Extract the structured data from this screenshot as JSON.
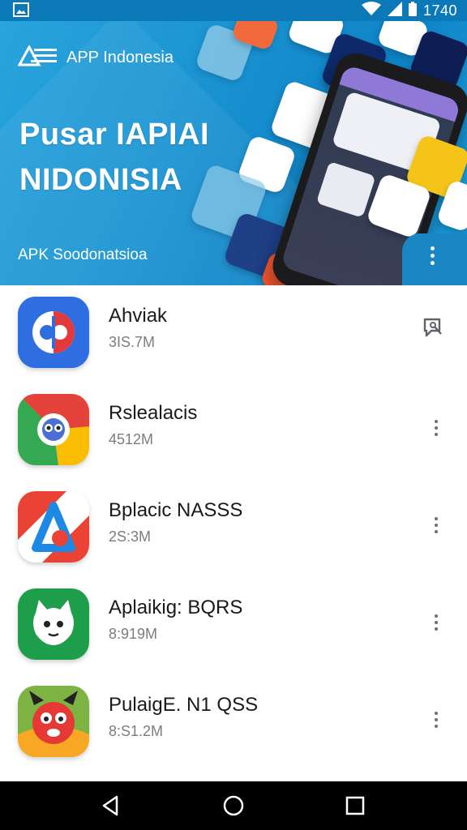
{
  "status_bar": {
    "time": "1740"
  },
  "hero": {
    "brand_name": "APP Indonesia",
    "title_line1": "Pusar IAPIAI",
    "title_line2": "NIDONISIA",
    "subtitle": "APK Soodonatsioa"
  },
  "apps": [
    {
      "name": "Ahviak",
      "size": "3IS.7M",
      "action_icon": "review-icon",
      "icon_colors": [
        "#2f6ee0",
        "#e23a3a"
      ]
    },
    {
      "name": "Rslealacis",
      "size": "4512M",
      "action_icon": "more-vert-icon",
      "icon_colors": [
        "#e3433a",
        "#fbbc04",
        "#34a853"
      ]
    },
    {
      "name": "Bplacic NASSS",
      "size": "2S:3M",
      "action_icon": "more-vert-icon",
      "icon_colors": [
        "#ea4335",
        "#1e88e5"
      ]
    },
    {
      "name": "Aplaikig: BQRS",
      "size": "8:919M",
      "action_icon": "more-vert-icon",
      "icon_colors": [
        "#1e9e4a"
      ]
    },
    {
      "name": "PulaigE. N1 QSS",
      "size": "8:S1.2M",
      "action_icon": "more-vert-icon",
      "icon_colors": [
        "#e53935",
        "#7cb342"
      ]
    }
  ],
  "nav": {
    "back": "back-icon",
    "home": "home-icon",
    "recents": "recents-icon"
  }
}
